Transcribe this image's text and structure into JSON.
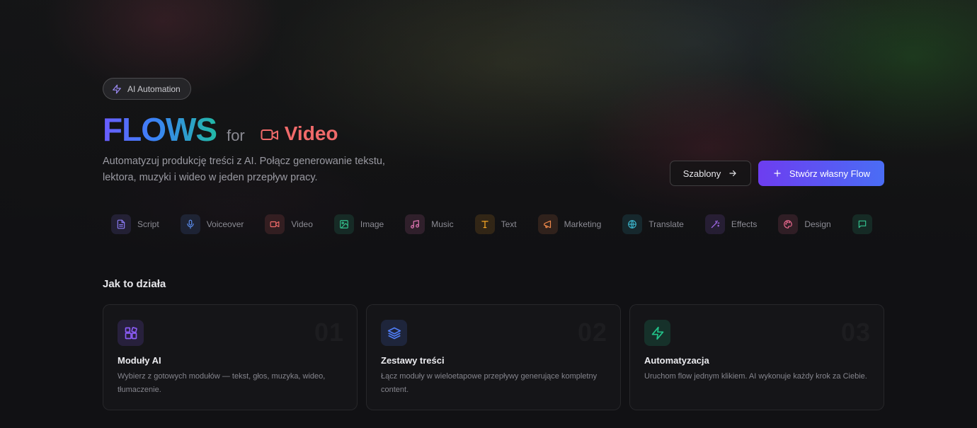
{
  "hero": {
    "badge_label": "AI Automation",
    "badge_icon": "zap-icon",
    "title_main": "FLOWS",
    "title_for": "for",
    "title_target": "Video",
    "subtitle": "Automatyzuj produkcję treści z AI. Połącz generowanie tekstu, lektora, muzyki i wideo w jeden przepływ pracy.",
    "templates_button": "Szablony",
    "create_button": "Stwórz własny Flow"
  },
  "colors": {
    "accent_purple": "#6d3df0",
    "accent_blue": "#4a6df5",
    "video_red": "#f06a6a"
  },
  "categories": [
    {
      "label": "Script",
      "icon": "file-text-icon",
      "color": "#8b7cf6"
    },
    {
      "label": "Voiceover",
      "icon": "mic-icon",
      "color": "#5b8def"
    },
    {
      "label": "Video",
      "icon": "video-icon",
      "color": "#f06a6a"
    },
    {
      "label": "Image",
      "icon": "image-icon",
      "color": "#34c38f"
    },
    {
      "label": "Music",
      "icon": "music-icon",
      "color": "#e879b9"
    },
    {
      "label": "Text",
      "icon": "type-icon",
      "color": "#f5a524"
    },
    {
      "label": "Marketing",
      "icon": "megaphone-icon",
      "color": "#f08a4b"
    },
    {
      "label": "Translate",
      "icon": "globe-icon",
      "color": "#3bb3c9"
    },
    {
      "label": "Effects",
      "icon": "wand-icon",
      "color": "#a66cf0"
    },
    {
      "label": "Design",
      "icon": "palette-icon",
      "color": "#ec6a8f"
    },
    {
      "label": "",
      "icon": "message-icon",
      "color": "#34c38f"
    }
  ],
  "how_it_works": {
    "title": "Jak to działa",
    "cards": [
      {
        "number": "01",
        "title": "Moduły AI",
        "desc": "Wybierz z gotowych modułów — tekst, głos, muzyka, wideo, tłumaczenie.",
        "icon": "blocks-icon",
        "color": "#8b5cf6"
      },
      {
        "number": "02",
        "title": "Zestawy treści",
        "desc": "Łącz moduły w wieloetapowe przepływy generujące kompletny content.",
        "icon": "layers-icon",
        "color": "#4f7df5"
      },
      {
        "number": "03",
        "title": "Automatyzacja",
        "desc": "Uruchom flow jednym klikiem. AI wykonuje każdy krok za Ciebie.",
        "icon": "zap-icon",
        "color": "#22c48a"
      }
    ]
  }
}
